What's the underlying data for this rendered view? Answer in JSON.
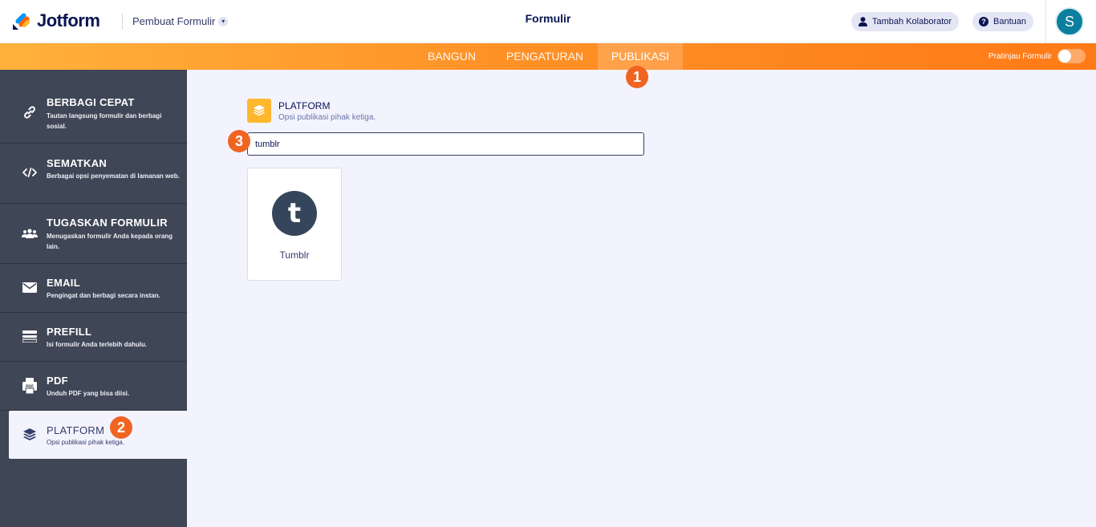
{
  "header": {
    "logo_text": "Jotform",
    "form_builder_label": "Pembuat Formulir",
    "form_title": "Formulir",
    "add_collaborator_label": "Tambah Kolaborator",
    "help_label": "Bantuan",
    "avatar_initial": "S"
  },
  "nav": {
    "tabs": [
      {
        "label": "BANGUN",
        "active": false
      },
      {
        "label": "PENGATURAN",
        "active": false
      },
      {
        "label": "PUBLIKASI",
        "active": true
      }
    ],
    "preview_label": "Pratinjau Formulir",
    "preview_on": false
  },
  "badges": [
    "1",
    "2",
    "3"
  ],
  "sidebar": {
    "items": [
      {
        "icon": "link-icon",
        "title": "BERBAGI CEPAT",
        "desc": "Tautan langsung formulir dan berbagi sosial.",
        "active": false
      },
      {
        "icon": "code-icon",
        "title": "SEMATKAN",
        "desc": "Berbagai opsi penyematan di lamanan web.",
        "active": false
      },
      {
        "icon": "users-icon",
        "title": "TUGASKAN FORMULIR",
        "desc": "Menugaskan formulir Anda kepada orang lain.",
        "active": false
      },
      {
        "icon": "envelope-icon",
        "title": "EMAIL",
        "desc": "Pengingat dan berbagi secara instan.",
        "active": false
      },
      {
        "icon": "prefill-icon",
        "title": "PREFILL",
        "desc": "Isi formulir Anda terlebih dahulu.",
        "active": false
      },
      {
        "icon": "pdf-icon",
        "title": "PDF",
        "desc": "Unduh PDF yang bisa diisi.",
        "active": false
      },
      {
        "icon": "layers-icon",
        "title": "PLATFORM",
        "desc": "Opsi publikasi pihak ketiga.",
        "active": true
      }
    ]
  },
  "main": {
    "section_title": "PLATFORM",
    "section_subtitle": "Opsi publikasi pihak ketiga.",
    "search_value": "tumblr",
    "results": [
      {
        "name": "Tumblr",
        "glyph": "t"
      }
    ]
  },
  "colors": {
    "brand_navy": "#0a1551",
    "orange_accent": "#ff7a16",
    "badge": "#f06422",
    "sidebar_bg": "#3f4656",
    "tumblr": "#35465c",
    "platform_icon": "#ffb72d"
  }
}
